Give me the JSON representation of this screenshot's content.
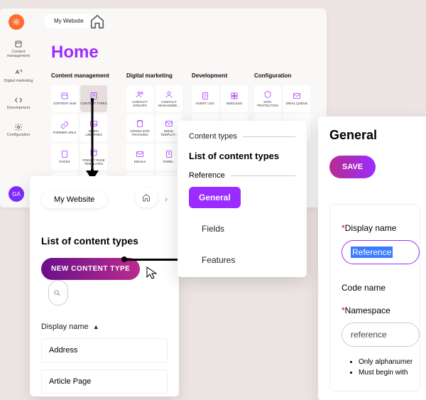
{
  "panelA": {
    "workspace": "My Website",
    "avatar": "GA",
    "title": "Home",
    "sidebar": [
      {
        "label": "Content management"
      },
      {
        "label": "Digital marketing"
      },
      {
        "label": "Development"
      },
      {
        "label": "Configuration"
      }
    ],
    "cols": {
      "cm": {
        "hdr": "Content management",
        "tiles": [
          "CONTENT HUB",
          "CONTENT TYPES",
          "FORMER URLS",
          "MEDIA LIBRARIES",
          "PAGES",
          "PRESET PAGE TEMPLATES"
        ]
      },
      "dm": {
        "hdr": "Digital marketing",
        "tiles": [
          "CONTACT GROUPS",
          "CONTACT MANAGEME...",
          "CROSS-SITE TRACKING",
          "EMAIL TEMPLAT...",
          "EMAILS",
          "FORM..."
        ]
      },
      "dev": {
        "hdr": "Development",
        "tiles": [
          "EVENT LOG",
          "MODULES"
        ]
      },
      "conf": {
        "hdr": "Configuration",
        "tiles": [
          "DATA PROTECTION",
          "EMAIL QUEUE"
        ]
      }
    }
  },
  "panelB": {
    "workspace": "My Website",
    "heading": "List of content types",
    "newBtn": "NEW CONTENT TYPE",
    "col": "Display name",
    "rows": [
      "Address",
      "Article Page"
    ]
  },
  "panelC": {
    "crumb": "Content types",
    "heading": "List of content types",
    "ref": "Reference",
    "tabs": [
      "General",
      "Fields",
      "Features"
    ]
  },
  "panelD": {
    "heading": "General",
    "save": "SAVE",
    "displayLabel": "Display name",
    "displayValue": "Reference",
    "codeLabel": "Code name",
    "nsLabel": "Namespace",
    "nsValue": "reference",
    "hints": [
      "Only alphanumer",
      "Must begin with"
    ]
  }
}
